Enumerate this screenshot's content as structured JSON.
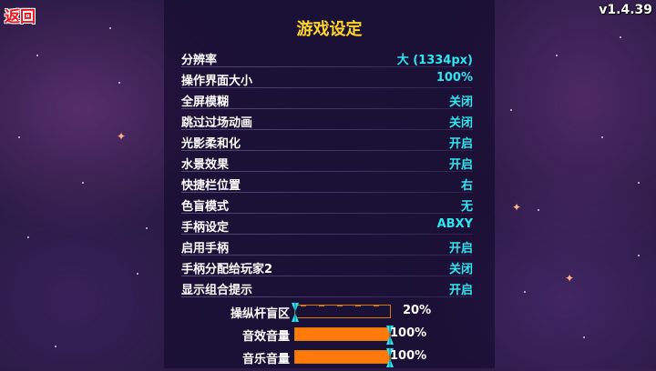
{
  "header": {
    "back_label": "返回",
    "version": "v1.4.39"
  },
  "panel": {
    "title": "游戏设定",
    "settings": [
      {
        "label": "分辨率",
        "value": "大 (1334px)"
      },
      {
        "label": "操作界面大小",
        "value": "100%"
      },
      {
        "label": "全屏模糊",
        "value": "关闭"
      },
      {
        "label": "跳过过场动画",
        "value": "关闭"
      },
      {
        "label": "光影柔和化",
        "value": "开启"
      },
      {
        "label": "水景效果",
        "value": "开启"
      },
      {
        "label": "快捷栏位置",
        "value": "右"
      },
      {
        "label": "色盲模式",
        "value": "无"
      },
      {
        "label": "手柄设定",
        "value": "ABXY"
      },
      {
        "label": "启用手柄",
        "value": "开启"
      },
      {
        "label": "手柄分配给玩家2",
        "value": "关闭"
      },
      {
        "label": "显示组合提示",
        "value": "开启"
      }
    ],
    "sliders": [
      {
        "label": "操纵杆盲区",
        "value_text": "20%",
        "level": 0.0
      },
      {
        "label": "音效音量",
        "value_text": "100%",
        "level": 1.0
      },
      {
        "label": "音乐音量",
        "value_text": "100%",
        "level": 1.0
      }
    ]
  },
  "colors": {
    "accent_value": "#2ee6f0",
    "title": "#ffd42a",
    "slider_fill": "#ff7a0a",
    "back": "#e8141e"
  }
}
